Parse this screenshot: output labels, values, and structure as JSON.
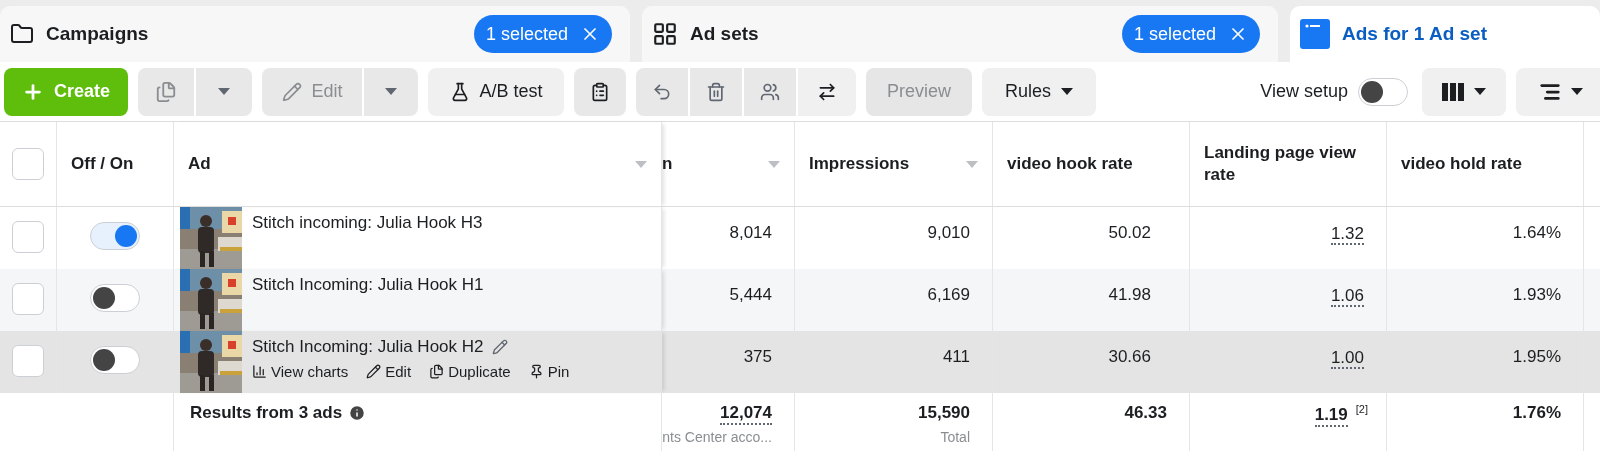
{
  "tabs": [
    {
      "kind": "campaigns",
      "label": "Campaigns",
      "selected": false,
      "badge": "1 selected"
    },
    {
      "kind": "adsets",
      "label": "Ad sets",
      "selected": false,
      "badge": "1 selected"
    },
    {
      "kind": "ads",
      "label": "Ads for 1 Ad set",
      "selected": true
    }
  ],
  "toolbar": {
    "create": {
      "label": "Create"
    },
    "duplicate": {
      "disabled": true
    },
    "edit": {
      "label": "Edit",
      "disabled": true
    },
    "ab_test": {
      "label": "A/B test"
    },
    "preview": {
      "label": "Preview",
      "disabled": true
    },
    "rules": {
      "label": "Rules"
    },
    "view_setup": {
      "label": "View setup",
      "on": false
    }
  },
  "table": {
    "all_checked": false,
    "columns": [
      {
        "label": "Off / On",
        "sortable": false
      },
      {
        "label": "Ad",
        "sortable": true
      },
      {
        "label": "n",
        "sortable": true
      },
      {
        "label": "Impressions",
        "sortable": true
      },
      {
        "label": "video hook rate",
        "sortable": false
      },
      {
        "label": "Landing page view rate",
        "sortable": false
      },
      {
        "label": "video hold rate",
        "sortable": false
      }
    ],
    "rows": [
      {
        "checked": false,
        "on": true,
        "hovered": false,
        "name": "Stitch incoming: Julia Hook H3",
        "cells": [
          "8,014",
          "9,010",
          "50.02",
          "1.32",
          "1.64%"
        ]
      },
      {
        "checked": false,
        "on": false,
        "hovered": false,
        "name": "Stitch Incoming: Julia Hook H1",
        "cells": [
          "5,444",
          "6,169",
          "41.98",
          "1.06",
          "1.93%"
        ]
      },
      {
        "checked": false,
        "on": false,
        "hovered": true,
        "name": "Stitch Incoming: Julia Hook H2",
        "actions": [
          "View charts",
          "Edit",
          "Duplicate",
          "Pin"
        ],
        "cells": [
          "375",
          "411",
          "30.66",
          "1.00",
          "1.95%"
        ]
      }
    ],
    "footer": {
      "label": "Results from 3 ads",
      "cells": [
        {
          "value": "12,074",
          "sub": "nts Center acco..."
        },
        {
          "value": "15,590",
          "sub": "Total"
        },
        {
          "value": "46.33"
        },
        {
          "value": "1.19",
          "note": "[2]"
        },
        {
          "value": "1.76%"
        }
      ]
    }
  }
}
